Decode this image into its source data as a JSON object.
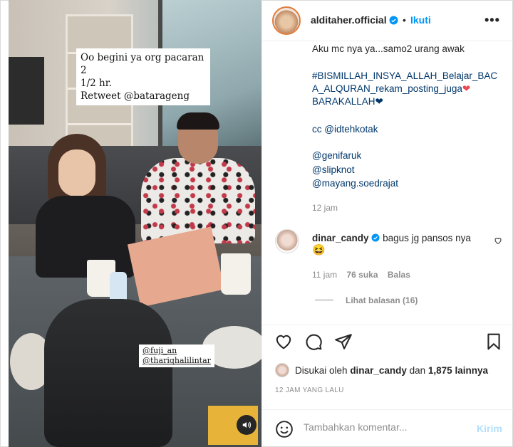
{
  "media": {
    "overlay_caption": [
      "Oo begini ya org pacaran 2",
      "1/2 hr.",
      "Retweet @batarageng"
    ],
    "tags": [
      "@fuji_an",
      "@thariqhalilintar"
    ],
    "sound_icon": "speaker-icon"
  },
  "header": {
    "username": "alditaher.official",
    "separator": "•",
    "follow_label": "Ikuti",
    "more_icon": "•••"
  },
  "caption": {
    "line1": "Aku mc nya ya...samo2 urang awak",
    "hashtags_line1": "#BISMILLAH_INSYA_ALLAH_Belajar_BAC",
    "hashtags_line2": "A_ALQURAN_rekam_posting_juga",
    "hashtags_line3": "BARAKALLAH",
    "cc": "cc @idtehkotak",
    "mentions": [
      "@genifaruk",
      "@slipknot",
      "@mayang.soedrajat"
    ],
    "time": "12 jam"
  },
  "comment": {
    "username": "dinar_candy",
    "text": "bagus jg pansos nya",
    "emoji": "😆",
    "time": "11 jam",
    "likes": "76 suka",
    "reply_label": "Balas",
    "view_replies": "Lihat balasan (16)"
  },
  "likes": {
    "prefix": "Disukai oleh",
    "user": "dinar_candy",
    "middle": "dan",
    "count": "1,875 lainnya"
  },
  "post_time": "12 JAM YANG LALU",
  "comment_box": {
    "placeholder": "Tambahkan komentar...",
    "post_label": "Kirim"
  },
  "colors": {
    "accent": "#0095f6",
    "hashtag": "#00376b",
    "muted": "#8e8e8e",
    "heart_red": "#ed4956",
    "heart_navy": "#00376b"
  }
}
